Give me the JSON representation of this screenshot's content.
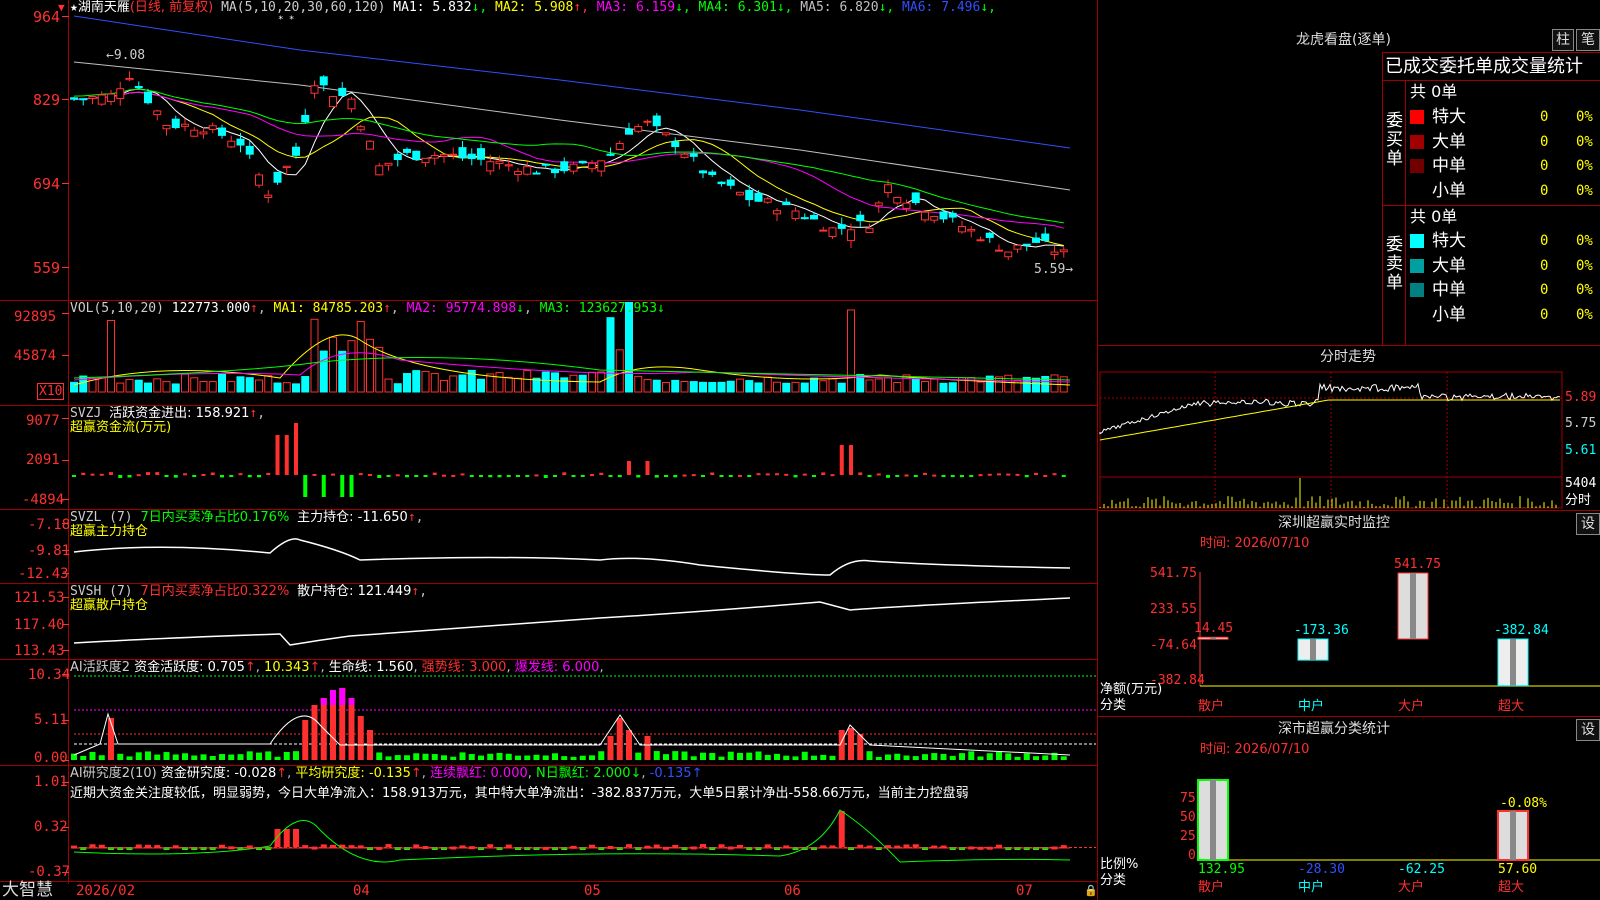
{
  "stock": {
    "star": "★",
    "name": "湖南天雁",
    "mode": "(日线, 前复权)",
    "ma_label": "MA(5,10,20,30,60,120)",
    "ma_values": [
      {
        "label": "MA1:",
        "value": "5.832",
        "arrow": "↓",
        "color": "#ffffff"
      },
      {
        "label": "MA2:",
        "value": "5.908",
        "arrow": "↑",
        "color": "#ffff00"
      },
      {
        "label": "MA3:",
        "value": "6.159",
        "arrow": "↓",
        "color": "#ff00ff"
      },
      {
        "label": "MA4:",
        "value": "6.301",
        "arrow": "↓",
        "color": "#00ff00"
      },
      {
        "label": "MA5:",
        "value": "6.820",
        "arrow": "↓",
        "color": "#c0c0c0"
      },
      {
        "label": "MA6:",
        "value": "7.496",
        "arrow": "↓",
        "color": "#3050ff"
      }
    ],
    "price_axis": [
      "964",
      "829",
      "694",
      "559"
    ],
    "high_mark": "9.08",
    "low_mark": "5.59→"
  },
  "vol": {
    "label": "VOL(5,10,20)",
    "value": "122773.000",
    "ma1": "MA1: 84785.203",
    "ma2": "MA2: 95774.898",
    "ma3": "MA3: 123627.953",
    "axis": [
      "92895",
      "45874"
    ],
    "unit": "X10"
  },
  "svzj": {
    "label": "SVZJ",
    "desc": "活跃资金进出: 158.921",
    "name": "超赢资金流(万元)",
    "axis": [
      "9077",
      "2091",
      "-4894"
    ]
  },
  "svzl": {
    "label": "SVZL (7)",
    "ratio": "7日内买卖净占比0.176%",
    "main": "主力持仓: -11.650",
    "name": "超赢主力持仓",
    "axis": [
      "-7.18",
      "-9.81",
      "-12.43"
    ]
  },
  "svsh": {
    "label": "SVSH (7)",
    "ratio": "7日内买卖净占比0.322%",
    "main": "散户持仓: 121.449",
    "name": "超赢散户持仓",
    "axis": [
      "121.53",
      "117.40",
      "113.43"
    ]
  },
  "ai1": {
    "label": "AI活跃度2",
    "active": "资金活跃度: 0.705",
    "v2": "10.343",
    "life": "生命线: 1.560",
    "strong": "强势线: 3.000",
    "burst": "爆发线: 6.000",
    "axis": [
      "10.34",
      "5.11",
      "0.00"
    ]
  },
  "ai2": {
    "label": "AI研究度2(10)",
    "research": "资金研究度: -0.028",
    "avg": "平均研究度: -0.135",
    "cont": "连续飘红: 0.000",
    "nday": "N日飘红: 2.000",
    "last": "-0.135",
    "comment": "近期大资金关注度较低，明显弱势，今日大单净流入：158.913万元，其中特大单净流出：-382.837万元，大单5日累计净出-558.66万元，当前主力控盘弱",
    "axis": [
      "1.01",
      "0.32",
      "-0.37"
    ]
  },
  "date_axis": [
    "2026/02",
    "04",
    "05",
    "06",
    "07"
  ],
  "brand": "大智慧",
  "right": {
    "lhb_title": "龙虎看盘(逐单)",
    "btn_zhu": "柱",
    "btn_bi": "笔",
    "stats_title": "已成交委托单成交量统计",
    "buy_total": "共 0单",
    "buy_label": "委买单",
    "sell_total": "共 0单",
    "sell_label": "委卖单",
    "buy_rows": [
      {
        "name": "特大",
        "count": "0",
        "pct": "0%",
        "color": "#ff0000"
      },
      {
        "name": "大单",
        "count": "0",
        "pct": "0%",
        "color": "#a00000"
      },
      {
        "name": "中单",
        "count": "0",
        "pct": "0%",
        "color": "#700000"
      },
      {
        "name": "小单",
        "count": "0",
        "pct": "0%",
        "color": ""
      }
    ],
    "sell_rows": [
      {
        "name": "特大",
        "count": "0",
        "pct": "0%",
        "color": "#00ffff"
      },
      {
        "name": "大单",
        "count": "0",
        "pct": "0%",
        "color": "#00a0a0"
      },
      {
        "name": "中单",
        "count": "0",
        "pct": "0%",
        "color": "#008080"
      },
      {
        "name": "小单",
        "count": "0",
        "pct": "0%",
        "color": ""
      }
    ],
    "intraday_title": "分时走势",
    "intraday_axis": [
      "5.89",
      "5.75",
      "5.61"
    ],
    "intraday_vol": "5404",
    "intraday_unit": "分时",
    "sz_title": "深圳超赢实时监控",
    "sz_btn": "设",
    "sz_time": "时间: 2026/07/10",
    "sz_axis": [
      "541.75",
      "233.55",
      "-74.64",
      "-382.84"
    ],
    "sz_ylabel": "净额(万元)",
    "sz_xlabel": "分类",
    "sz_bars": [
      {
        "cat": "散户",
        "value": 14.45,
        "label": "14.45"
      },
      {
        "cat": "中户",
        "value": -173.36,
        "label": "-173.36"
      },
      {
        "cat": "大户",
        "value": 541.75,
        "label": "541.75"
      },
      {
        "cat": "超大",
        "value": -382.84,
        "label": "-382.84"
      }
    ],
    "cls_title": "深市超赢分类统计",
    "cls_btn": "设",
    "cls_time": "时间: 2026/07/10",
    "cls_axis": [
      "75",
      "50",
      "25",
      "0"
    ],
    "cls_ylabel": "比例%",
    "cls_xlabel": "分类",
    "cls_cats": [
      "散户",
      "中户",
      "大户",
      "超大"
    ],
    "cls_values": [
      "132.95",
      "-28.30",
      "-62.25",
      "57.60"
    ],
    "cls_note": "-0.08%"
  }
}
